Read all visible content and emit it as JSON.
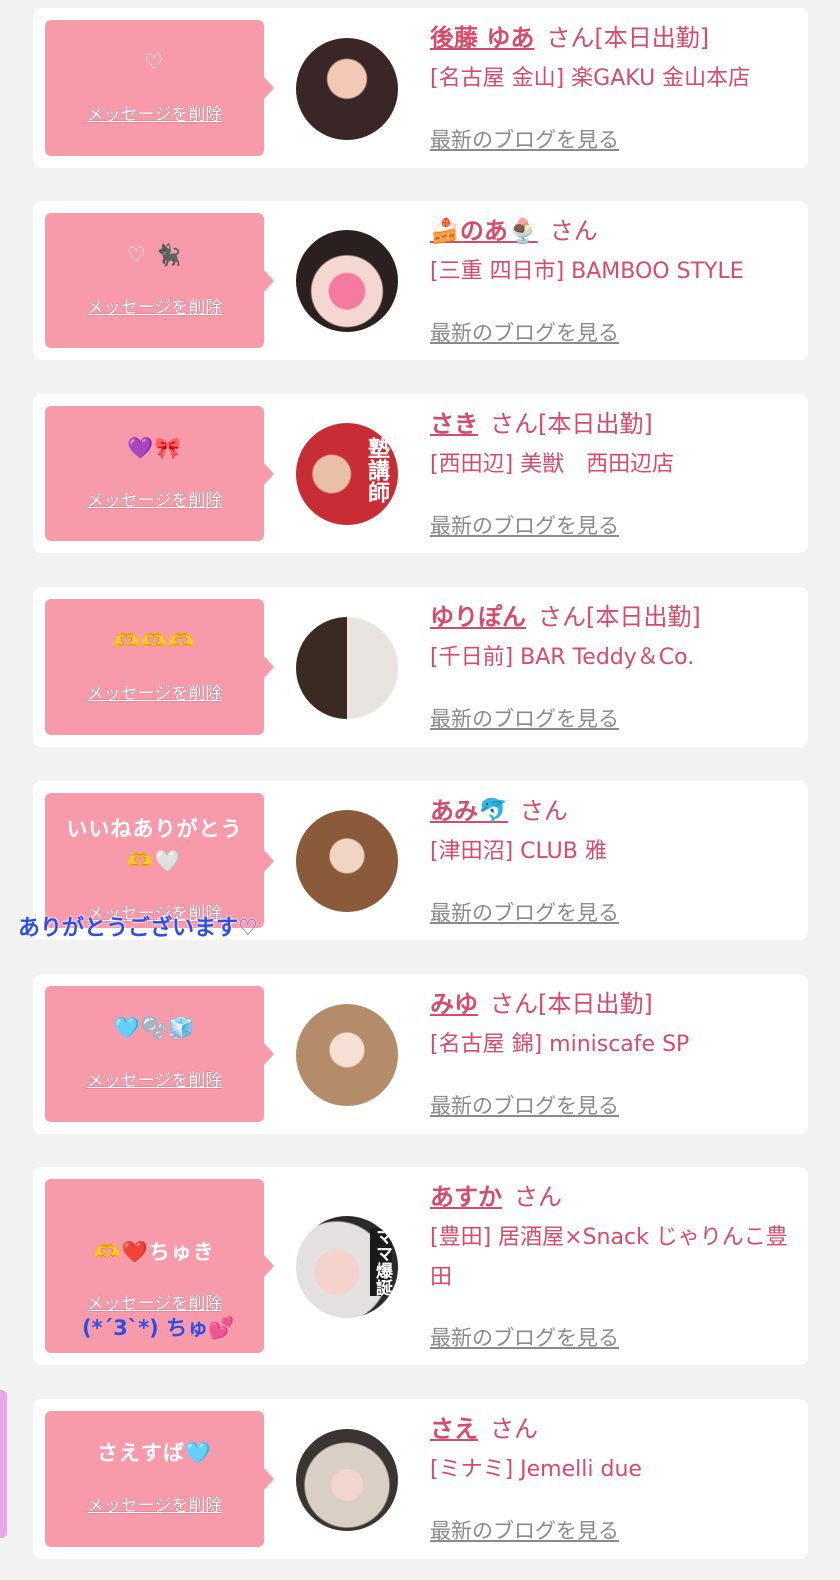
{
  "colors": {
    "page_bg": "#f2f2f2",
    "card_bg": "#ffffff",
    "bubble_bg": "#f79aaa",
    "name_color": "#d64a6b",
    "blog_link_color": "#8a8a8a",
    "overlay_blue": "#2a4ee8"
  },
  "labels": {
    "delete": "メッセージを削除",
    "blog": "最新のブログを見る",
    "suffix_on_duty": "さん[本日出勤]",
    "suffix": "さん"
  },
  "cards": [
    {
      "message": "♡",
      "name": "後藤 ゆあ",
      "suffix": "さん[本日出勤]",
      "shop": "[名古屋 金山] 楽GAKU 金山本店"
    },
    {
      "message": "♡ 🐈‍⬛",
      "name": "🍰のあ🍨",
      "suffix": "さん",
      "shop": "[三重 四日市] BAMBOO STYLE"
    },
    {
      "message": "💜🎀",
      "name": "さき",
      "suffix": "さん[本日出勤]",
      "shop": "[西田辺] 美獣　西田辺店",
      "avatar_text": "塾講師"
    },
    {
      "message": "🫶🫶🫶",
      "name": "ゆりぽん",
      "suffix": "さん[本日出勤]",
      "shop": "[千日前] BAR Teddy＆Co."
    },
    {
      "message": "いいねありがとう",
      "message2": "🫶🤍",
      "name": "あみ🐬",
      "suffix": "さん",
      "shop": "[津田沼] CLUB 雅"
    },
    {
      "message": "🩵🫧🧊",
      "name": "みゆ",
      "suffix": "さん[本日出勤]",
      "shop": "[名古屋 錦] miniscafe SP"
    },
    {
      "message": "🫶❤️ちゅき",
      "name": "あすか",
      "suffix": "さん",
      "shop": "[豊田] 居酒屋×Snack じゃりんこ豊田",
      "avatar_text": "ママ爆誕"
    },
    {
      "message": "さえすば🩵",
      "name": "さえ",
      "suffix": "さん",
      "shop": "[ミナミ] Jemelli due"
    }
  ],
  "overlays": {
    "thanks": "ありがとうございます♡",
    "chu": "(*´3`*) ちゅ💕"
  }
}
